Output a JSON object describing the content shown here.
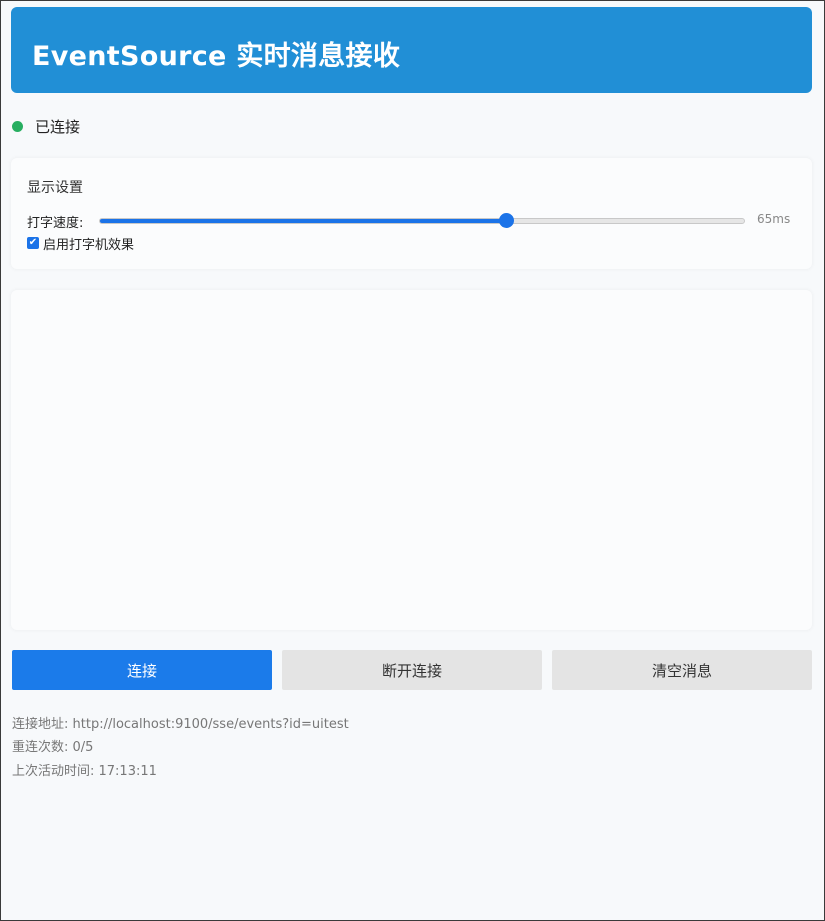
{
  "header": {
    "title": "EventSource 实时消息接收"
  },
  "status": {
    "text": "已连接",
    "color": "#27ae60"
  },
  "settings": {
    "title": "显示设置",
    "speed_label": "打字速度:",
    "speed_value": "65ms",
    "speed_fraction": 0.63,
    "typewriter_label": "启用打字机效果",
    "typewriter_checked": true
  },
  "buttons": {
    "connect": "连接",
    "disconnect": "断开连接",
    "clear": "清空消息"
  },
  "info": {
    "url_line": "连接地址: http://localhost:9100/sse/events?id=uitest",
    "retry_line": "重连次数: 0/5",
    "last_activity_line": "上次活动时间: 17:13:11"
  },
  "colors": {
    "header_bg": "#218fd6",
    "accent": "#1b7bea"
  }
}
